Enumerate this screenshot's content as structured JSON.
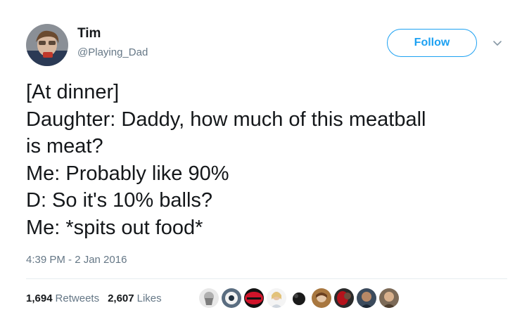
{
  "author": {
    "name": "Tim",
    "handle": "@Playing_Dad",
    "follow_label": "Follow"
  },
  "tweet": {
    "lines": [
      "[At dinner]",
      "Daughter: Daddy, how much of this meatball",
      "is meat?",
      "Me: Probably like 90%",
      "D: So it's 10% balls?",
      "Me: *spits out food*"
    ],
    "timestamp": "4:39 PM - 2 Jan 2016"
  },
  "stats": {
    "retweets_count": "1,694",
    "retweets_label": "Retweets",
    "likes_count": "2,607",
    "likes_label": "Likes"
  },
  "colors": {
    "accent": "#1da1f2",
    "secondary_text": "#657786",
    "primary_text": "#14171a"
  },
  "icons": {
    "menu": "chevron-down-icon"
  }
}
